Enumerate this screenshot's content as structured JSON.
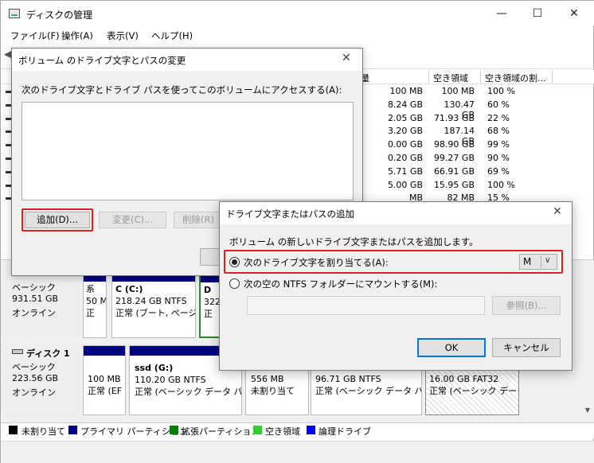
{
  "app": {
    "title": "ディスクの管理",
    "controls": {
      "minimize": "—",
      "maximize": "☐",
      "close": "✕"
    }
  },
  "menu": [
    "ファイル(F)",
    "操作(A)",
    "表示(V)",
    "ヘルプ(H)"
  ],
  "volume_list": {
    "columns": [
      "量",
      "空き領域",
      "空き領域の割..."
    ],
    "rows": [
      [
        "100 MB",
        "100 MB",
        "100 %"
      ],
      [
        "8.24 GB",
        "130.47 GB",
        "60 %"
      ],
      [
        "2.05 GB",
        "71.93 GB",
        "22 %"
      ],
      [
        "3.20 GB",
        "187.14 GB",
        "68 %"
      ],
      [
        "0.00 GB",
        "98.90 GB",
        "99 %"
      ],
      [
        "0.20 GB",
        "99.27 GB",
        "90 %"
      ],
      [
        "5.71 GB",
        "66.91 GB",
        "69 %"
      ],
      [
        "5.00 GB",
        "15.95 GB",
        "100 %"
      ],
      [
        "MB",
        "82 MB",
        "15 %"
      ]
    ]
  },
  "disks": [
    {
      "status": [
        "ベーシック",
        "931.51 GB",
        "オンライン"
      ],
      "partitions": [
        {
          "lines": [
            "系",
            "50 M",
            "正"
          ]
        },
        {
          "lines": [
            "C (C:)",
            "218.24 GB NTFS",
            "正常 (ブート, ページ"
          ]
        },
        {
          "lines": [
            "D",
            "322",
            "正"
          ]
        }
      ]
    },
    {
      "name": "ディスク 1",
      "status": [
        "ベーシック",
        "223.56 GB",
        "オンライン"
      ],
      "partitions": [
        {
          "lines": [
            "100 MB",
            "正常 (EF"
          ]
        },
        {
          "lines": [
            "ssd (G:)",
            "110.20 GB NTFS",
            "正常 (ベーシック データ パー"
          ]
        },
        {
          "lines": [
            "556 MB",
            "未割り当て"
          ]
        },
        {
          "lines": [
            "96.71 GB NTFS",
            "正常 (ベーシック データ パー"
          ]
        },
        {
          "lines": [
            "16.00 GB FAT32",
            "正常 (ベーシック データ"
          ]
        }
      ]
    }
  ],
  "legend": [
    {
      "label": "未割り当て",
      "color": "#000000"
    },
    {
      "label": "プライマリ パーティション",
      "color": "#000080"
    },
    {
      "label": "拡張パーティション",
      "color": "#008000"
    },
    {
      "label": "空き領域",
      "color": "#33cc33"
    },
    {
      "label": "論理ドライブ",
      "color": "#0000ff"
    }
  ],
  "dialog_change": {
    "title": "ボリューム のドライブ文字とパスの変更",
    "description": "次のドライブ文字とドライブ パスを使ってこのボリュームにアクセスする(A):",
    "add_label": "追加(D)...",
    "change_label": "変更(C)...",
    "remove_label": "削除(R)"
  },
  "dialog_add": {
    "title": "ドライブ文字またはパスの追加",
    "intro": "ボリューム の新しいドライブ文字またはパスを追加します。",
    "assign_label": "次のドライブ文字を割り当てる(A):",
    "assign_value": "M",
    "mount_label": "次の空の NTFS フォルダーにマウントする(M):",
    "browse_label": "参照(B)...",
    "ok_label": "OK",
    "cancel_label": "キャンセル"
  }
}
